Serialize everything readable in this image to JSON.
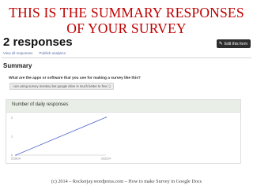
{
  "slide": {
    "title_line1": "THIS IS THE SUMMARY  RESPONSES",
    "title_line2": "OF YOUR SURVEY",
    "footer": "(c) 2014 – Rockerjay.wordpress.com – How to make Survey in Google Docs"
  },
  "form": {
    "heading": "2 responses",
    "edit_button_label": "Edit this form",
    "edit_icon": "pencil-icon",
    "links": [
      "View all responses",
      "Publish analytics"
    ],
    "summary_heading": "Summary",
    "question": "What are the apps or software that you use for making a survey like this?",
    "answer": "i am using survey monkey but google drive is much better to free :)"
  },
  "chart_data": {
    "type": "line",
    "title": "Number of daily responses",
    "x": [
      "2/15/14",
      "2/22/14"
    ],
    "series": [
      {
        "values": [
          0,
          2
        ]
      }
    ],
    "yticks": [
      0,
      1,
      2
    ],
    "ylim": [
      0,
      2
    ],
    "colors": {
      "line": "#5b6fd0"
    },
    "grid": false,
    "legend": "none"
  }
}
